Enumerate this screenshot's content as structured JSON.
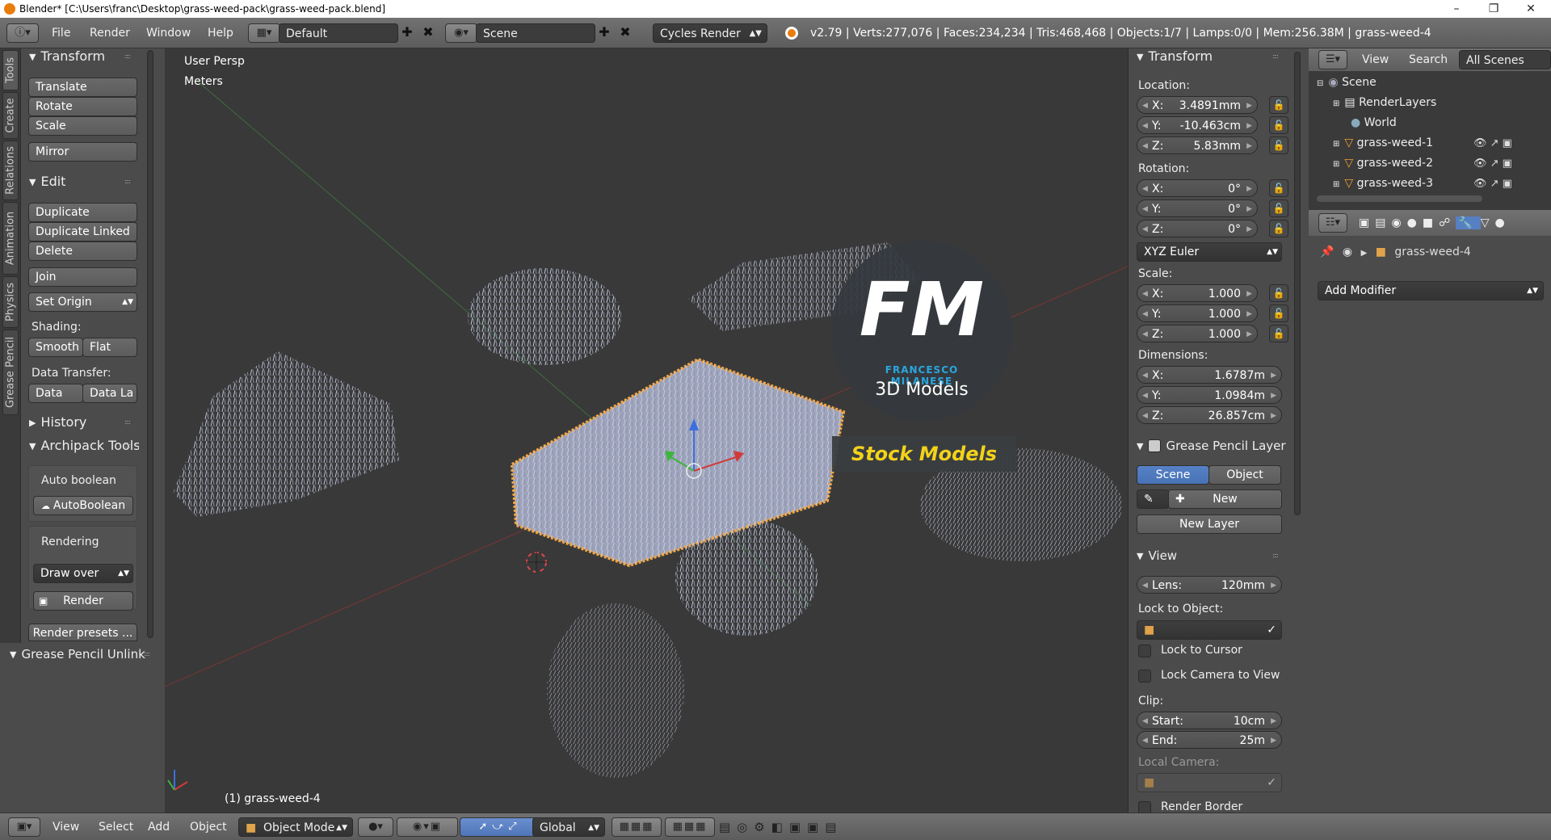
{
  "window": {
    "title": "Blender* [C:\\Users\\franc\\Desktop\\grass-weed-pack\\grass-weed-pack.blend]"
  },
  "topbar": {
    "menus": [
      "File",
      "Render",
      "Window",
      "Help"
    ],
    "screen_layout": "Default",
    "scene": "Scene",
    "render_engine": "Cycles Render",
    "stats": "v2.79 | Verts:277,076 | Faces:234,234 | Tris:468,468 | Objects:1/7 | Lamps:0/0 | Mem:256.38M | grass-weed-4"
  },
  "shelf_tabs": [
    "Tools",
    "Create",
    "Relations",
    "Animation",
    "Physics",
    "Grease Pencil"
  ],
  "toolshelf": {
    "transform": {
      "header": "Transform",
      "translate": "Translate",
      "rotate": "Rotate",
      "scale": "Scale",
      "mirror": "Mirror"
    },
    "edit": {
      "header": "Edit",
      "duplicate": "Duplicate",
      "duplicate_linked": "Duplicate Linked",
      "delete": "Delete",
      "join": "Join",
      "set_origin": "Set Origin",
      "shading_label": "Shading:",
      "smooth": "Smooth",
      "flat": "Flat",
      "data_transfer_label": "Data Transfer:",
      "data": "Data",
      "data_la": "Data La"
    },
    "history": {
      "header": "History"
    },
    "archipack": {
      "header": "Archipack Tools",
      "auto_boolean_label": "Auto boolean",
      "auto_boolean_btn": "AutoBoolean",
      "rendering_label": "Rendering",
      "draw_over": "Draw over",
      "render": "Render",
      "render_presets": "Render presets ..."
    },
    "grease_pencil_unlink": {
      "header": "Grease Pencil Unlink"
    }
  },
  "viewport": {
    "view_name": "User Persp",
    "units": "Meters",
    "object_label": "(1) grass-weed-4",
    "watermark": {
      "fm": "FM",
      "name": "FRANCESCO MILANESE",
      "models": "3D Models",
      "stock": "Stock Models"
    }
  },
  "npanel": {
    "transform_header": "Transform",
    "location_label": "Location:",
    "location": [
      {
        "k": "X:",
        "v": "3.4891mm"
      },
      {
        "k": "Y:",
        "v": "-10.463cm"
      },
      {
        "k": "Z:",
        "v": "5.83mm"
      }
    ],
    "rotation_label": "Rotation:",
    "rotation": [
      {
        "k": "X:",
        "v": "0°"
      },
      {
        "k": "Y:",
        "v": "0°"
      },
      {
        "k": "Z:",
        "v": "0°"
      }
    ],
    "rotation_mode": "XYZ Euler",
    "scale_label": "Scale:",
    "scale": [
      {
        "k": "X:",
        "v": "1.000"
      },
      {
        "k": "Y:",
        "v": "1.000"
      },
      {
        "k": "Z:",
        "v": "1.000"
      }
    ],
    "dimensions_label": "Dimensions:",
    "dimensions": [
      {
        "k": "X:",
        "v": "1.6787m"
      },
      {
        "k": "Y:",
        "v": "1.0984m"
      },
      {
        "k": "Z:",
        "v": "26.857cm"
      }
    ],
    "gp_header": "Grease Pencil Layer",
    "gp_scene": "Scene",
    "gp_object": "Object",
    "gp_new": "New",
    "gp_new_layer": "New Layer",
    "view_header": "View",
    "lens_k": "Lens:",
    "lens_v": "120mm",
    "lock_to_object": "Lock to Object:",
    "lock_to_cursor": "Lock to Cursor",
    "lock_camera": "Lock Camera to View",
    "clip_label": "Clip:",
    "clip_start_k": "Start:",
    "clip_start_v": "10cm",
    "clip_end_k": "End:",
    "clip_end_v": "25m",
    "local_camera": "Local Camera:",
    "render_border": "Render Border"
  },
  "outliner": {
    "menus": [
      "View",
      "Search"
    ],
    "filter": "All Scenes",
    "rows": [
      "Scene",
      "RenderLayers",
      "World",
      "grass-weed-1",
      "grass-weed-2",
      "grass-weed-3"
    ]
  },
  "properties": {
    "object_name": "grass-weed-4",
    "add_modifier": "Add Modifier"
  },
  "bottombar": {
    "menus": [
      "View",
      "Select",
      "Add",
      "Object"
    ],
    "mode": "Object Mode",
    "orientation": "Global"
  },
  "colors": {
    "selection_orange": "#f5a742",
    "accent_blue": "#5680c2",
    "logo_blue": "#2aa6de",
    "stock_yellow": "#f2d21b"
  }
}
